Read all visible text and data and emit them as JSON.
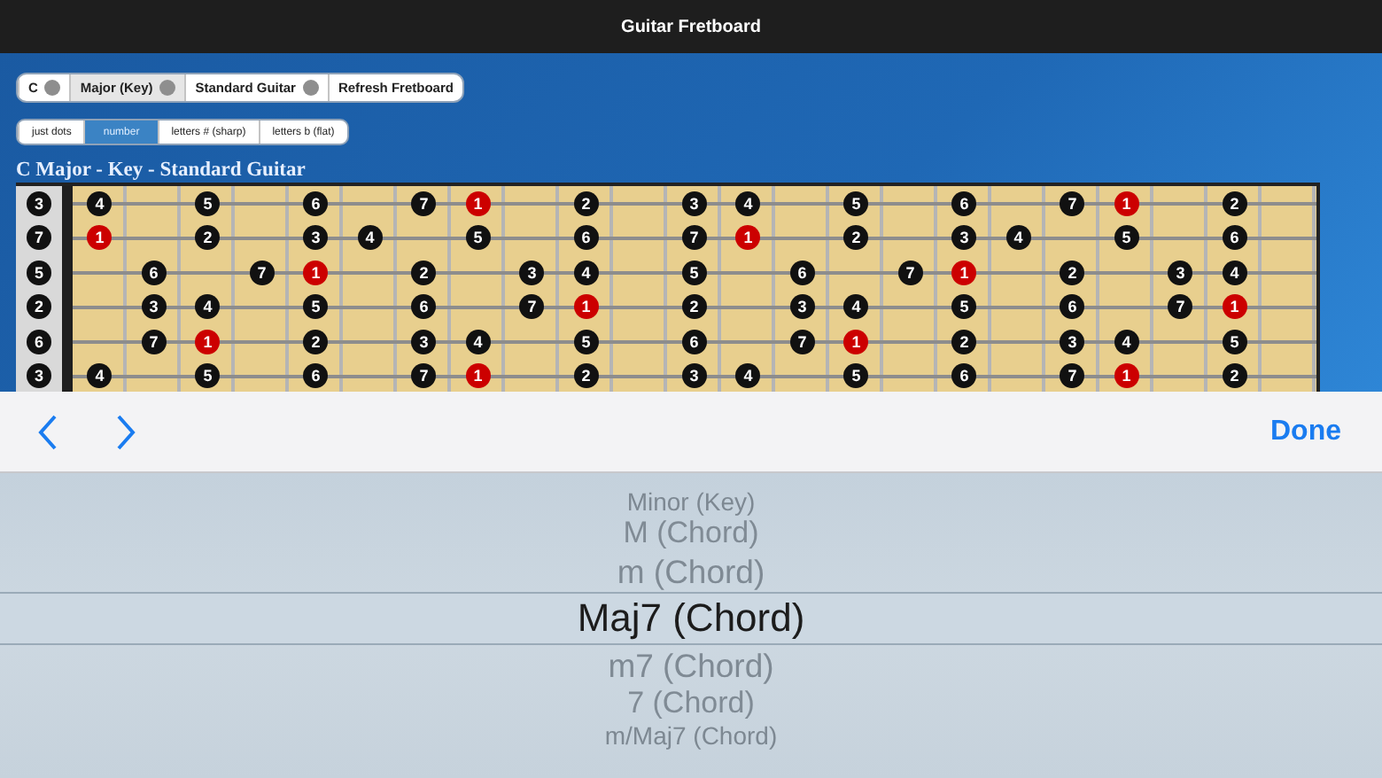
{
  "window": {
    "title": "Guitar Fretboard"
  },
  "selectors": [
    {
      "label": "C",
      "dropdown": true,
      "selected": false
    },
    {
      "label": "Major (Key)",
      "dropdown": true,
      "selected": true
    },
    {
      "label": "Standard Guitar",
      "dropdown": true,
      "selected": false
    },
    {
      "label": "Refresh Fretboard",
      "dropdown": false,
      "selected": false
    }
  ],
  "display_modes": [
    {
      "label": "just dots",
      "selected": false
    },
    {
      "label": "number",
      "selected": true
    },
    {
      "label": "letters # (sharp)",
      "selected": false
    },
    {
      "label": "letters b (flat)",
      "selected": false
    }
  ],
  "heading": "C Major - Key - Standard Guitar",
  "fretboard": {
    "strings": [
      {
        "open": {
          "label": "3",
          "color": "#111111"
        },
        "frets": [
          {
            "kind": "note",
            "label": "4",
            "color": "#111111"
          },
          {
            "kind": "empty"
          },
          {
            "kind": "note",
            "label": "5",
            "color": "#111111"
          },
          {
            "kind": "empty"
          },
          {
            "kind": "note",
            "label": "6",
            "color": "#111111"
          },
          {
            "kind": "empty"
          },
          {
            "kind": "note",
            "label": "7",
            "color": "#111111"
          },
          {
            "kind": "note",
            "label": "1",
            "color": "#cc0000"
          },
          {
            "kind": "empty"
          },
          {
            "kind": "note",
            "label": "2",
            "color": "#111111"
          },
          {
            "kind": "empty"
          },
          {
            "kind": "note",
            "label": "3",
            "color": "#111111"
          },
          {
            "kind": "note",
            "label": "4",
            "color": "#111111"
          },
          {
            "kind": "empty"
          },
          {
            "kind": "note",
            "label": "5",
            "color": "#111111"
          },
          {
            "kind": "empty"
          },
          {
            "kind": "note",
            "label": "6",
            "color": "#111111"
          },
          {
            "kind": "empty"
          },
          {
            "kind": "note",
            "label": "7",
            "color": "#111111"
          },
          {
            "kind": "note",
            "label": "1",
            "color": "#cc0000"
          },
          {
            "kind": "empty"
          },
          {
            "kind": "note",
            "label": "2",
            "color": "#111111"
          },
          {
            "kind": "empty"
          }
        ]
      },
      {
        "open": {
          "label": "7",
          "color": "#111111"
        },
        "frets": [
          {
            "kind": "note",
            "label": "1",
            "color": "#cc0000"
          },
          {
            "kind": "empty"
          },
          {
            "kind": "note",
            "label": "2",
            "color": "#111111"
          },
          {
            "kind": "empty"
          },
          {
            "kind": "note",
            "label": "3",
            "color": "#111111"
          },
          {
            "kind": "note",
            "label": "4",
            "color": "#111111"
          },
          {
            "kind": "empty"
          },
          {
            "kind": "note",
            "label": "5",
            "color": "#111111"
          },
          {
            "kind": "empty"
          },
          {
            "kind": "note",
            "label": "6",
            "color": "#111111"
          },
          {
            "kind": "empty"
          },
          {
            "kind": "note",
            "label": "7",
            "color": "#111111"
          },
          {
            "kind": "note",
            "label": "1",
            "color": "#cc0000"
          },
          {
            "kind": "empty"
          },
          {
            "kind": "note",
            "label": "2",
            "color": "#111111"
          },
          {
            "kind": "empty"
          },
          {
            "kind": "note",
            "label": "3",
            "color": "#111111"
          },
          {
            "kind": "note",
            "label": "4",
            "color": "#111111"
          },
          {
            "kind": "empty"
          },
          {
            "kind": "note",
            "label": "5",
            "color": "#111111"
          },
          {
            "kind": "empty"
          },
          {
            "kind": "note",
            "label": "6",
            "color": "#111111"
          },
          {
            "kind": "empty"
          }
        ]
      },
      {
        "open": {
          "label": "5",
          "color": "#111111"
        },
        "frets": [
          {
            "kind": "empty"
          },
          {
            "kind": "note",
            "label": "6",
            "color": "#111111"
          },
          {
            "kind": "empty"
          },
          {
            "kind": "note",
            "label": "7",
            "color": "#111111"
          },
          {
            "kind": "note",
            "label": "1",
            "color": "#cc0000"
          },
          {
            "kind": "empty"
          },
          {
            "kind": "note",
            "label": "2",
            "color": "#111111"
          },
          {
            "kind": "empty"
          },
          {
            "kind": "note",
            "label": "3",
            "color": "#111111"
          },
          {
            "kind": "note",
            "label": "4",
            "color": "#111111"
          },
          {
            "kind": "empty"
          },
          {
            "kind": "note",
            "label": "5",
            "color": "#111111"
          },
          {
            "kind": "empty"
          },
          {
            "kind": "note",
            "label": "6",
            "color": "#111111"
          },
          {
            "kind": "empty"
          },
          {
            "kind": "note",
            "label": "7",
            "color": "#111111"
          },
          {
            "kind": "note",
            "label": "1",
            "color": "#cc0000"
          },
          {
            "kind": "empty"
          },
          {
            "kind": "note",
            "label": "2",
            "color": "#111111"
          },
          {
            "kind": "empty"
          },
          {
            "kind": "note",
            "label": "3",
            "color": "#111111"
          },
          {
            "kind": "note",
            "label": "4",
            "color": "#111111"
          },
          {
            "kind": "empty"
          }
        ]
      },
      {
        "open": {
          "label": "2",
          "color": "#111111"
        },
        "frets": [
          {
            "kind": "empty"
          },
          {
            "kind": "note",
            "label": "3",
            "color": "#111111"
          },
          {
            "kind": "note",
            "label": "4",
            "color": "#111111"
          },
          {
            "kind": "empty"
          },
          {
            "kind": "note",
            "label": "5",
            "color": "#111111"
          },
          {
            "kind": "empty"
          },
          {
            "kind": "note",
            "label": "6",
            "color": "#111111"
          },
          {
            "kind": "empty"
          },
          {
            "kind": "note",
            "label": "7",
            "color": "#111111"
          },
          {
            "kind": "note",
            "label": "1",
            "color": "#cc0000"
          },
          {
            "kind": "empty"
          },
          {
            "kind": "note",
            "label": "2",
            "color": "#111111"
          },
          {
            "kind": "empty"
          },
          {
            "kind": "note",
            "label": "3",
            "color": "#111111"
          },
          {
            "kind": "note",
            "label": "4",
            "color": "#111111"
          },
          {
            "kind": "empty"
          },
          {
            "kind": "note",
            "label": "5",
            "color": "#111111"
          },
          {
            "kind": "empty"
          },
          {
            "kind": "note",
            "label": "6",
            "color": "#111111"
          },
          {
            "kind": "empty"
          },
          {
            "kind": "note",
            "label": "7",
            "color": "#111111"
          },
          {
            "kind": "note",
            "label": "1",
            "color": "#cc0000"
          },
          {
            "kind": "empty"
          }
        ]
      },
      {
        "open": {
          "label": "6",
          "color": "#111111"
        },
        "frets": [
          {
            "kind": "empty"
          },
          {
            "kind": "note",
            "label": "7",
            "color": "#111111"
          },
          {
            "kind": "note",
            "label": "1",
            "color": "#cc0000"
          },
          {
            "kind": "empty"
          },
          {
            "kind": "note",
            "label": "2",
            "color": "#111111"
          },
          {
            "kind": "empty"
          },
          {
            "kind": "note",
            "label": "3",
            "color": "#111111"
          },
          {
            "kind": "note",
            "label": "4",
            "color": "#111111"
          },
          {
            "kind": "empty"
          },
          {
            "kind": "note",
            "label": "5",
            "color": "#111111"
          },
          {
            "kind": "empty"
          },
          {
            "kind": "note",
            "label": "6",
            "color": "#111111"
          },
          {
            "kind": "empty"
          },
          {
            "kind": "note",
            "label": "7",
            "color": "#111111"
          },
          {
            "kind": "note",
            "label": "1",
            "color": "#cc0000"
          },
          {
            "kind": "empty"
          },
          {
            "kind": "note",
            "label": "2",
            "color": "#111111"
          },
          {
            "kind": "empty"
          },
          {
            "kind": "note",
            "label": "3",
            "color": "#111111"
          },
          {
            "kind": "note",
            "label": "4",
            "color": "#111111"
          },
          {
            "kind": "empty"
          },
          {
            "kind": "note",
            "label": "5",
            "color": "#111111"
          },
          {
            "kind": "empty"
          }
        ]
      },
      {
        "open": {
          "label": "3",
          "color": "#111111"
        },
        "frets": [
          {
            "kind": "note",
            "label": "4",
            "color": "#111111"
          },
          {
            "kind": "empty"
          },
          {
            "kind": "note",
            "label": "5",
            "color": "#111111"
          },
          {
            "kind": "empty"
          },
          {
            "kind": "note",
            "label": "6",
            "color": "#111111"
          },
          {
            "kind": "empty"
          },
          {
            "kind": "note",
            "label": "7",
            "color": "#111111"
          },
          {
            "kind": "note",
            "label": "1",
            "color": "#cc0000"
          },
          {
            "kind": "empty"
          },
          {
            "kind": "note",
            "label": "2",
            "color": "#111111"
          },
          {
            "kind": "empty"
          },
          {
            "kind": "note",
            "label": "3",
            "color": "#111111"
          },
          {
            "kind": "note",
            "label": "4",
            "color": "#111111"
          },
          {
            "kind": "empty"
          },
          {
            "kind": "note",
            "label": "5",
            "color": "#111111"
          },
          {
            "kind": "empty"
          },
          {
            "kind": "note",
            "label": "6",
            "color": "#111111"
          },
          {
            "kind": "empty"
          },
          {
            "kind": "note",
            "label": "7",
            "color": "#111111"
          },
          {
            "kind": "note",
            "label": "1",
            "color": "#cc0000"
          },
          {
            "kind": "empty"
          },
          {
            "kind": "note",
            "label": "2",
            "color": "#111111"
          },
          {
            "kind": "empty"
          }
        ]
      }
    ]
  },
  "picker_toolbar": {
    "done": "Done"
  },
  "picker": {
    "items": [
      {
        "label": "Minor (Key)",
        "selected": false
      },
      {
        "label": "M (Chord)",
        "selected": false
      },
      {
        "label": "m (Chord)",
        "selected": false
      },
      {
        "label": "Maj7 (Chord)",
        "selected": true
      },
      {
        "label": "m7 (Chord)",
        "selected": false
      },
      {
        "label": "7 (Chord)",
        "selected": false
      },
      {
        "label": "m/Maj7 (Chord)",
        "selected": false
      }
    ]
  }
}
